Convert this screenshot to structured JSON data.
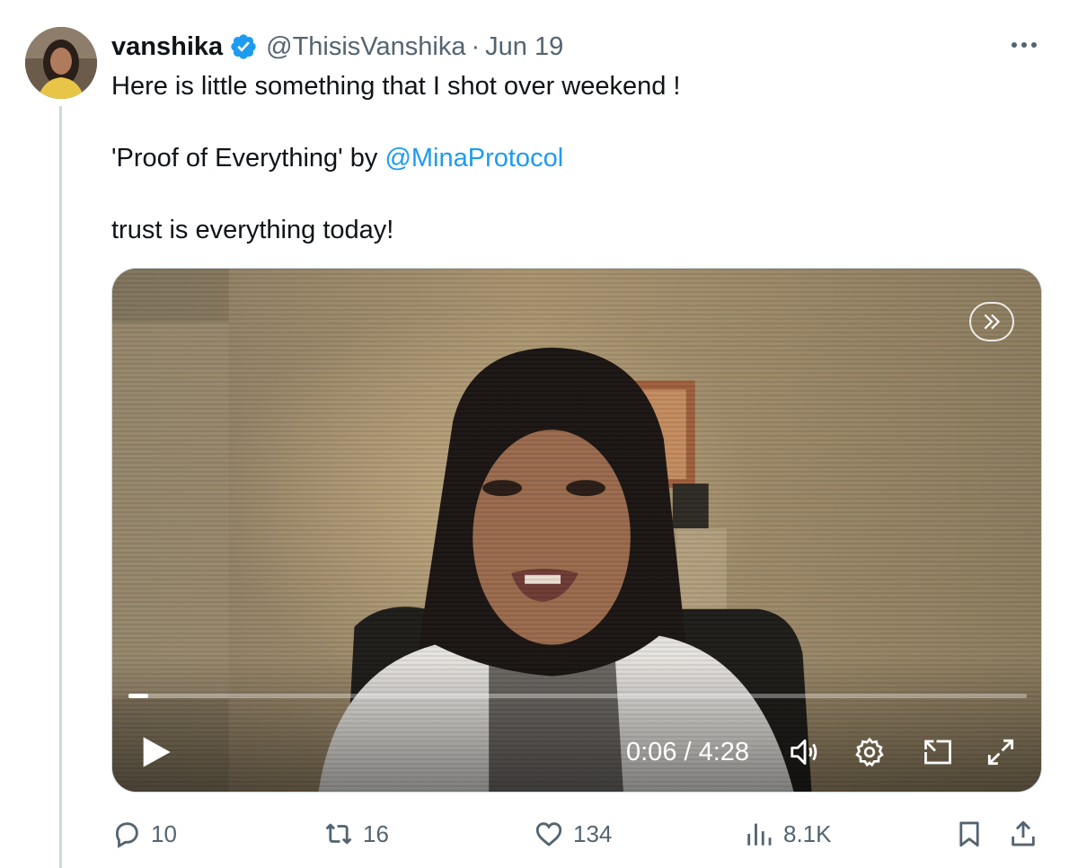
{
  "tweet": {
    "author_name": "vanshika",
    "handle": "@ThisisVanshika",
    "separator": "·",
    "date": "Jun 19",
    "line1": "Here is little something that I shot over weekend !",
    "line2_prefix": "'Proof of Everything' by ",
    "line2_mention": "@MinaProtocol",
    "line3": "trust is everything today!"
  },
  "video": {
    "time_display": "0:06 / 4:28",
    "progress_fraction": 0.022
  },
  "actions": {
    "replies": "10",
    "reposts": "16",
    "likes": "134",
    "views": "8.1K"
  },
  "colors": {
    "accent": "#1d9bf0",
    "muted": "#536471",
    "text": "#0f1419",
    "verified": "#1d9bf0"
  },
  "icons": {
    "verified": "verified-badge-icon",
    "more": "more-options-icon",
    "skip": "skip-forward-icon",
    "play": "play-icon",
    "volume": "volume-icon",
    "settings": "settings-gear-icon",
    "pip": "picture-in-picture-icon",
    "fullscreen": "fullscreen-icon",
    "reply": "reply-icon",
    "repost": "repost-icon",
    "like": "heart-icon",
    "views": "views-chart-icon",
    "bookmark": "bookmark-icon",
    "share": "share-icon"
  }
}
